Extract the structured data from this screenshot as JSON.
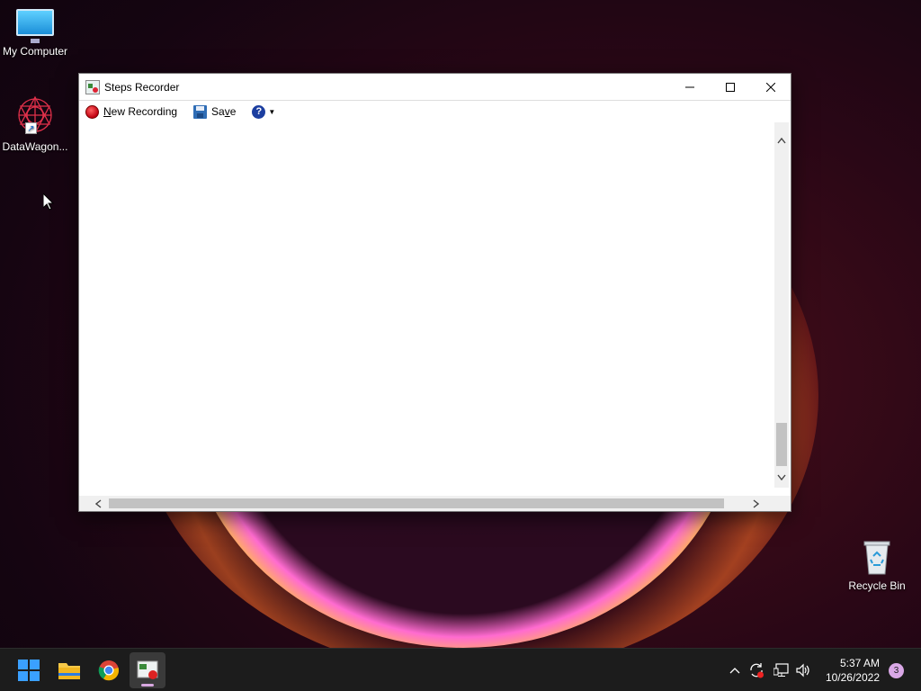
{
  "desktop": {
    "icons": [
      {
        "label": "My Computer",
        "icon": "monitor-icon"
      },
      {
        "label": "DataWagon...",
        "icon": "datawagon-logo-icon"
      },
      {
        "label": "Recycle Bin",
        "icon": "recycle-bin-icon"
      }
    ]
  },
  "window": {
    "title": "Steps Recorder",
    "controls": {
      "minimize": "minimize-icon",
      "maximize": "maximize-icon",
      "close": "close-icon"
    },
    "toolbar": {
      "new_recording_label": "New Recording",
      "save_label": "Save",
      "help_glyph": "?"
    }
  },
  "taskbar": {
    "apps": [
      "start-icon",
      "file-explorer-icon",
      "chrome-icon",
      "steps-recorder-icon"
    ],
    "clock": {
      "time": "5:37 AM",
      "date": "10/26/2022"
    },
    "notification_count": "3"
  },
  "colors": {
    "taskbar": "#1c1c1c",
    "record_red": "#c00010",
    "accent_windows": "#3aa0ff"
  }
}
